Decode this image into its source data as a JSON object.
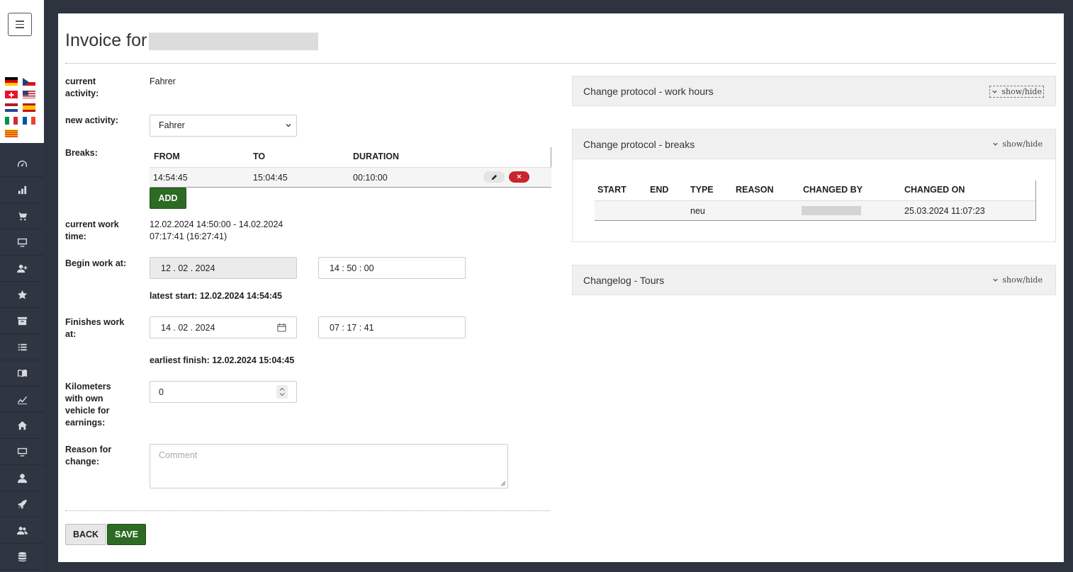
{
  "sidebar": {
    "menu_icon": "hamburger-icon",
    "flags": [
      "germany",
      "czech-republic",
      "switzerland",
      "united-states",
      "netherlands",
      "spain",
      "italy",
      "france",
      "catalonia"
    ],
    "nav_icons": [
      "dashboard-icon",
      "bar-chart-icon",
      "cart-icon",
      "monitor-icon",
      "user-plus-icon",
      "star-icon",
      "archive-icon",
      "list-icon",
      "book-icon",
      "line-chart-icon",
      "home-icon",
      "desktop-icon",
      "user-icon",
      "rocket-icon",
      "users-icon",
      "database-icon"
    ]
  },
  "page": {
    "title": "Invoice for"
  },
  "form": {
    "current_activity_label": "current activity:",
    "current_activity_value": "Fahrer",
    "new_activity_label": "new activity:",
    "new_activity_value": "Fahrer",
    "breaks_label": "Breaks:",
    "breaks_headers": [
      "FROM",
      "TO",
      "DURATION"
    ],
    "breaks_rows": [
      {
        "from": "14:54:45",
        "to": "15:04:45",
        "duration": "00:10:00"
      }
    ],
    "delete_label": "×",
    "add_label": "ADD",
    "current_work_time_label": "current work time:",
    "current_work_time_line1": "12.02.2024 14:50:00 - 14.02.2024",
    "current_work_time_line2": "07:17:41 (16:27:41)",
    "begin_label": "Begin work at:",
    "begin_date": "12 . 02 . 2024",
    "begin_time": "14 : 50 : 00",
    "latest_start": "latest start: 12.02.2024 14:54:45",
    "finish_label": "Finishes work at:",
    "finish_date": "14 . 02 . 2024",
    "finish_time": "07 : 17 : 41",
    "earliest_finish": "earliest finish: 12.02.2024 15:04:45",
    "km_label": "Kilometers with own vehicle for earnings:",
    "km_value": "0",
    "reason_label": "Reason for change:",
    "reason_placeholder": "Comment",
    "back_label": "BACK",
    "save_label": "SAVE"
  },
  "panels": {
    "work_hours": {
      "title": "Change protocol - work hours",
      "toggle": "show/hide"
    },
    "breaks": {
      "title": "Change protocol - breaks",
      "toggle": "show/hide",
      "headers": [
        "START",
        "END",
        "TYPE",
        "REASON",
        "CHANGED BY",
        "CHANGED ON"
      ],
      "rows": [
        {
          "start": "",
          "end": "",
          "type": "neu",
          "reason": "",
          "changed_by": "",
          "changed_on": "25.03.2024 11:07:23"
        }
      ]
    },
    "tours": {
      "title": "Changelog - Tours",
      "toggle": "show/hide"
    }
  },
  "colors": {
    "sidebar_bg": "#2f3642",
    "primary_green": "#2d6a23",
    "danger_red": "#c9252c",
    "panel_header_bg": "#f0f0f0"
  }
}
